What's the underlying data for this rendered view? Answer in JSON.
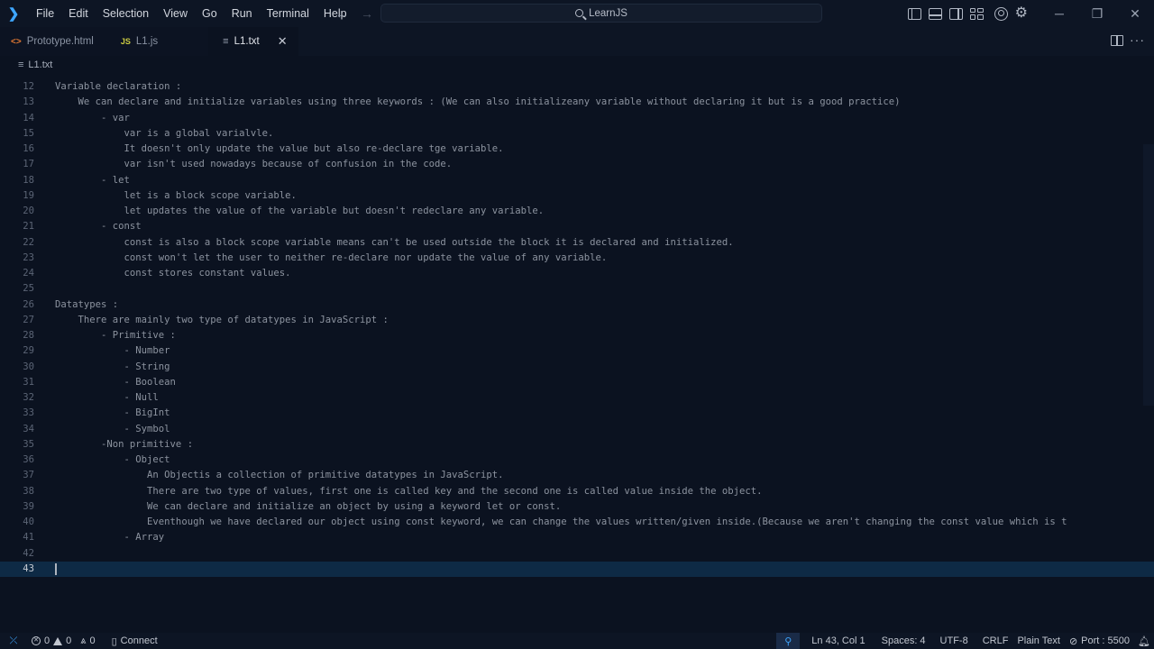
{
  "titlebar": {
    "menu": [
      "File",
      "Edit",
      "Selection",
      "View",
      "Go",
      "Run",
      "Terminal",
      "Help"
    ],
    "search_text": "LearnJS"
  },
  "tabs": [
    {
      "label": "Prototype.html",
      "icon": "html-file-icon"
    },
    {
      "label": "L1.js",
      "icon": "js-file-icon"
    },
    {
      "label": "L1.txt",
      "icon": "text-file-icon",
      "active": true
    }
  ],
  "breadcrumb": {
    "file": "L1.txt"
  },
  "editor": {
    "current_line": "43",
    "lines": [
      {
        "n": "12",
        "t": "Variable declaration :"
      },
      {
        "n": "13",
        "t": "    We can declare and initialize variables using three keywords : (We can also initializeany variable without declaring it but is a good practice)"
      },
      {
        "n": "14",
        "t": "        - var"
      },
      {
        "n": "15",
        "t": "            var is a global varialvle."
      },
      {
        "n": "16",
        "t": "            It doesn't only update the value but also re-declare tge variable."
      },
      {
        "n": "17",
        "t": "            var isn't used nowadays because of confusion in the code."
      },
      {
        "n": "18",
        "t": "        - let"
      },
      {
        "n": "19",
        "t": "            let is a block scope variable."
      },
      {
        "n": "20",
        "t": "            let updates the value of the variable but doesn't redeclare any variable."
      },
      {
        "n": "21",
        "t": "        - const"
      },
      {
        "n": "22",
        "t": "            const is also a block scope variable means can't be used outside the block it is declared and initialized."
      },
      {
        "n": "23",
        "t": "            const won't let the user to neither re-declare nor update the value of any variable."
      },
      {
        "n": "24",
        "t": "            const stores constant values."
      },
      {
        "n": "25",
        "t": ""
      },
      {
        "n": "26",
        "t": "Datatypes :"
      },
      {
        "n": "27",
        "t": "    There are mainly two type of datatypes in JavaScript :"
      },
      {
        "n": "28",
        "t": "        - Primitive :"
      },
      {
        "n": "29",
        "t": "            - Number"
      },
      {
        "n": "30",
        "t": "            - String"
      },
      {
        "n": "31",
        "t": "            - Boolean"
      },
      {
        "n": "32",
        "t": "            - Null"
      },
      {
        "n": "33",
        "t": "            - BigInt"
      },
      {
        "n": "34",
        "t": "            - Symbol"
      },
      {
        "n": "35",
        "t": "        -Non primitive :"
      },
      {
        "n": "36",
        "t": "            - Object"
      },
      {
        "n": "37",
        "t": "                An Objectis a collection of primitive datatypes in JavaScript."
      },
      {
        "n": "38",
        "t": "                There are two type of values, first one is called key and the second one is called value inside the object."
      },
      {
        "n": "39",
        "t": "                We can declare and initialize an object by using a keyword let or const."
      },
      {
        "n": "40",
        "t": "                Eventhough we have declared our object using const keyword, we can change the values written/given inside.(Because we aren't changing the const value which is t"
      },
      {
        "n": "41",
        "t": "            - Array"
      },
      {
        "n": "42",
        "t": ""
      },
      {
        "n": "43",
        "t": ""
      }
    ]
  },
  "statusbar": {
    "errors": "0",
    "warnings": "0",
    "ports_count": "0",
    "connect": "Connect",
    "position": "Ln 43, Col 1",
    "spaces": "Spaces: 4",
    "encoding": "UTF-8",
    "eol": "CRLF",
    "language": "Plain Text",
    "port": "Port : 5500"
  }
}
